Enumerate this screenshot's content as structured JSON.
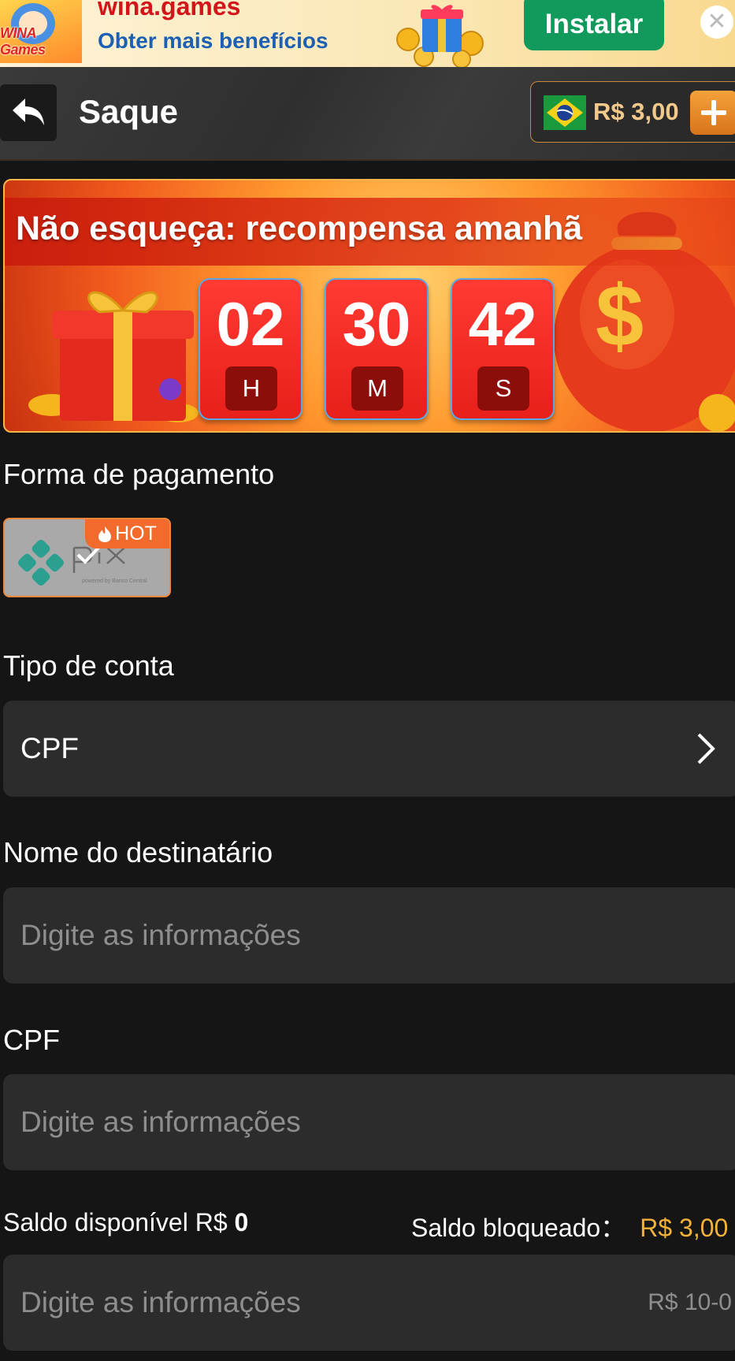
{
  "ad_banner": {
    "logo_text": "WINA Games",
    "title": "wina.games",
    "subtitle": "Obter mais benefícios",
    "install_label": "Instalar",
    "close_symbol": "✕",
    "colors": {
      "title": "#d3151b",
      "subtitle": "#1d5fb3",
      "install_bg": "#119a5c"
    }
  },
  "header": {
    "back_icon": "back-arrow-icon",
    "title": "Saque",
    "balance": "R$ 3,00",
    "flag_icon": "brazil-flag-icon",
    "add_icon": "plus-icon"
  },
  "promo": {
    "title": "Não esqueça: recompensa amanhã",
    "countdown": [
      {
        "value": "02",
        "unit": "H"
      },
      {
        "value": "30",
        "unit": "M"
      },
      {
        "value": "42",
        "unit": "S"
      }
    ]
  },
  "payment": {
    "label": "Forma de pagamento",
    "method": "PIX",
    "badge": "HOT",
    "selected": true
  },
  "account_type": {
    "label": "Tipo de conta",
    "value": "CPF"
  },
  "recipient": {
    "label": "Nome do destinatário",
    "placeholder": "Digite as informações"
  },
  "cpf": {
    "label": "CPF",
    "placeholder": "Digite as informações"
  },
  "balances": {
    "available_label": "Saldo disponível R$",
    "available_value": "0",
    "blocked_label": "Saldo bloqueado：",
    "blocked_value": "R$ 3,00"
  },
  "amount": {
    "placeholder": "Digite as informações",
    "range_hint": "R$ 10-0"
  }
}
